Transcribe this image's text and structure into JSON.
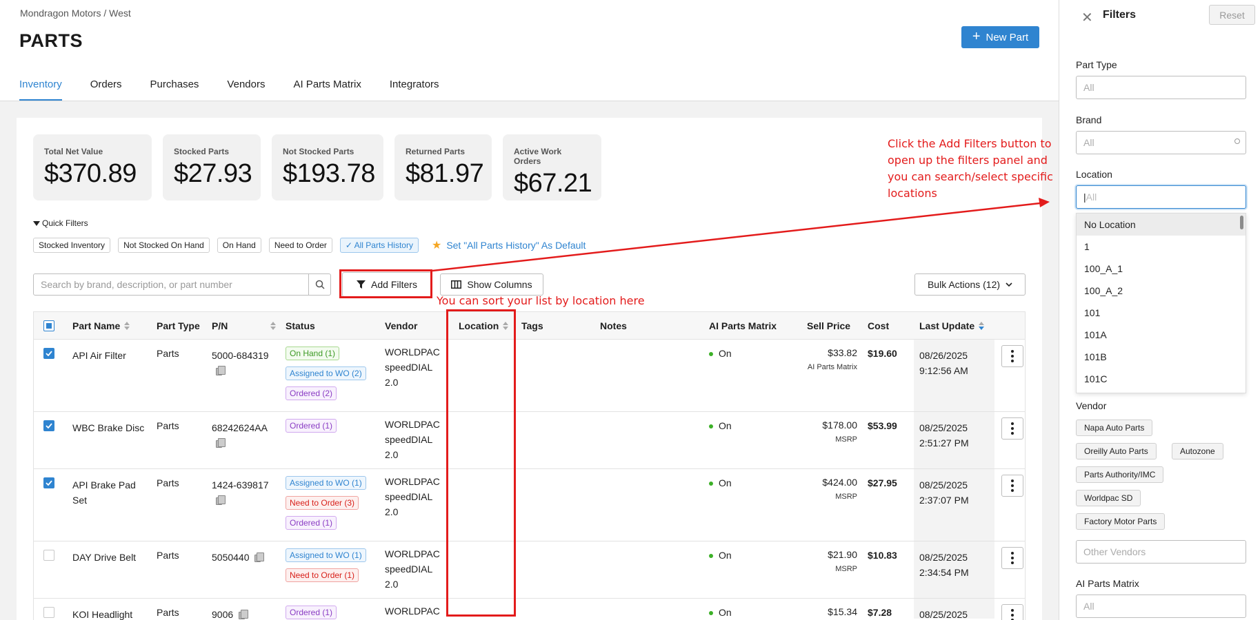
{
  "breadcrumb": "Mondragon Motors / West",
  "page_title": "PARTS",
  "new_part_label": "New Part",
  "tabs": [
    {
      "label": "Inventory"
    },
    {
      "label": "Orders"
    },
    {
      "label": "Purchases"
    },
    {
      "label": "Vendors"
    },
    {
      "label": "AI Parts Matrix"
    },
    {
      "label": "Integrators"
    }
  ],
  "stats": [
    {
      "label": "Total Net Value",
      "value": "$370.89"
    },
    {
      "label": "Stocked Parts",
      "value": "$27.93"
    },
    {
      "label": "Not Stocked Parts",
      "value": "$193.78"
    },
    {
      "label": "Returned Parts",
      "value": "$81.97"
    },
    {
      "label": "Active Work Orders",
      "value": "$67.21"
    }
  ],
  "quick_filters": {
    "title": "Quick Filters",
    "chips": [
      "Stocked Inventory",
      "Not Stocked On Hand",
      "On Hand",
      "Need to Order",
      "All Parts History"
    ],
    "set_default": "Set \"All Parts History\" As Default"
  },
  "search": {
    "placeholder": "Search by brand, description, or part number"
  },
  "toolbar": {
    "add_filters": "Add Filters",
    "show_columns": "Show Columns",
    "bulk_actions": "Bulk Actions (12)"
  },
  "table": {
    "headers": {
      "part_name": "Part Name",
      "part_type": "Part Type",
      "pn": "P/N",
      "status": "Status",
      "vendor": "Vendor",
      "location": "Location",
      "tags": "Tags",
      "notes": "Notes",
      "ai_matrix": "AI Parts Matrix",
      "sell_price": "Sell Price",
      "cost": "Cost",
      "last_update": "Last Update"
    },
    "rows": [
      {
        "name": "API Air Filter",
        "type": "Parts",
        "pn": "5000-684319",
        "checked": true,
        "statuses": [
          {
            "text": "On Hand (1)",
            "color": "green"
          },
          {
            "text": "Assigned to WO (2)",
            "color": "blue"
          },
          {
            "text": "Ordered (2)",
            "color": "purple"
          }
        ],
        "vendor": [
          "WORLDPAC",
          "speedDIAL",
          "2.0"
        ],
        "ai": "On",
        "sell": "$33.82",
        "sell_sub": "AI Parts Matrix",
        "cost": "$19.60",
        "updated_date": "08/26/2025",
        "updated_time": "9:12:56 AM"
      },
      {
        "name": "WBC Brake Disc",
        "type": "Parts",
        "pn": "68242624AA",
        "checked": true,
        "statuses": [
          {
            "text": "Ordered (1)",
            "color": "purple"
          }
        ],
        "vendor": [
          "WORLDPAC",
          "speedDIAL",
          "2.0"
        ],
        "ai": "On",
        "sell": "$178.00",
        "sell_sub": "MSRP",
        "cost": "$53.99",
        "updated_date": "08/25/2025",
        "updated_time": "2:51:27 PM"
      },
      {
        "name": "API Brake Pad Set",
        "type": "Parts",
        "pn": "1424-639817",
        "checked": true,
        "statuses": [
          {
            "text": "Assigned to WO (1)",
            "color": "blue"
          },
          {
            "text": "Need to Order (3)",
            "color": "red"
          },
          {
            "text": "Ordered (1)",
            "color": "purple"
          }
        ],
        "vendor": [
          "WORLDPAC",
          "speedDIAL",
          "2.0"
        ],
        "ai": "On",
        "sell": "$424.00",
        "sell_sub": "MSRP",
        "cost": "$27.95",
        "updated_date": "08/25/2025",
        "updated_time": "2:37:07 PM"
      },
      {
        "name": "DAY Drive Belt",
        "type": "Parts",
        "pn": "5050440",
        "checked": false,
        "statuses": [
          {
            "text": "Assigned to WO (1)",
            "color": "blue"
          },
          {
            "text": "Need to Order (1)",
            "color": "red"
          }
        ],
        "vendor": [
          "WORLDPAC",
          "speedDIAL",
          "2.0"
        ],
        "ai": "On",
        "sell": "$21.90",
        "sell_sub": "MSRP",
        "cost": "$10.83",
        "updated_date": "08/25/2025",
        "updated_time": "2:34:54 PM"
      },
      {
        "name": "KOI Headlight",
        "type": "Parts",
        "pn": "9006",
        "checked": false,
        "statuses": [
          {
            "text": "Ordered (1)",
            "color": "purple"
          }
        ],
        "vendor": [
          "WORLDPAC"
        ],
        "ai": "On",
        "sell": "$15.34",
        "sell_sub": "",
        "cost": "$7.28",
        "updated_date": "08/25/2025",
        "updated_time": ""
      }
    ]
  },
  "filters_panel": {
    "title": "Filters",
    "reset": "Reset",
    "part_type": {
      "label": "Part Type",
      "placeholder": "All"
    },
    "brand": {
      "label": "Brand",
      "placeholder": "All"
    },
    "location": {
      "label": "Location",
      "placeholder": "All",
      "options": [
        "No Location",
        "1",
        "100_A_1",
        "100_A_2",
        "101",
        "101A",
        "101B",
        "101C"
      ]
    },
    "vendor": {
      "label": "Vendor",
      "chips": [
        "Napa Auto Parts",
        "Oreilly Auto Parts",
        "Autozone",
        "Parts Authority/IMC",
        "Worldpac SD",
        "Factory Motor Parts"
      ],
      "other_placeholder": "Other Vendors"
    },
    "ai_matrix": {
      "label": "AI Parts Matrix",
      "placeholder": "All"
    }
  },
  "annotations": {
    "filters_note": "Click the Add Filters button to open up the filters panel and you can search/select specific locations",
    "sort_note": "You can sort your list by location here"
  },
  "colors": {
    "accent": "#2f84d0",
    "annotation": "#e31b1b"
  }
}
